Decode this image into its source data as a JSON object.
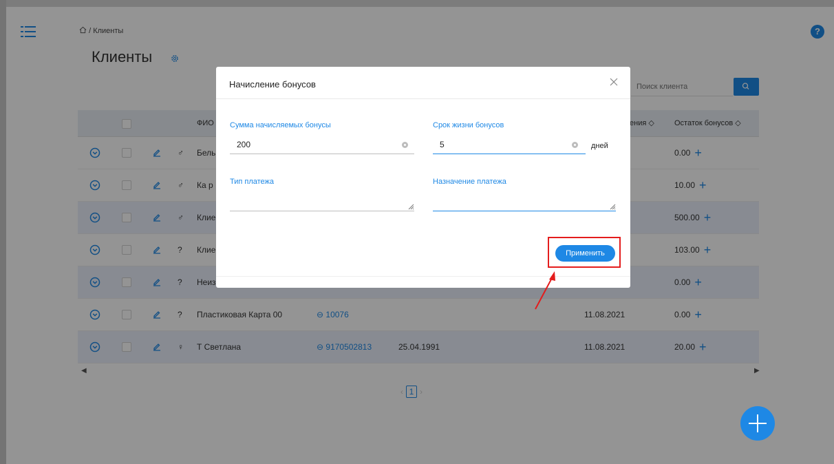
{
  "breadcrumb": {
    "home_icon": "home-icon",
    "separator": "/",
    "current": "Клиенты"
  },
  "page": {
    "title": "Клиенты",
    "settings_icon": "gear-icon"
  },
  "search": {
    "placeholder": "Поиск клиента",
    "icon": "search-icon"
  },
  "table": {
    "headers": {
      "name": "ФИО",
      "registration_partial": "ения ◇",
      "bonus_balance": "Остаток бонусов ◇"
    },
    "rows": [
      {
        "gender": "♂",
        "name": "Бель",
        "phone": "",
        "birthday": "",
        "registered": "",
        "bonus": "0.00"
      },
      {
        "gender": "♂",
        "name": "Ка р",
        "phone": "",
        "birthday": "",
        "registered": "",
        "bonus": "10.00"
      },
      {
        "gender": "♂",
        "name": "Клие",
        "phone": "",
        "birthday": "",
        "registered": "",
        "bonus": "500.00"
      },
      {
        "gender": "?",
        "name": "Клие",
        "phone": "",
        "birthday": "",
        "registered": "",
        "bonus": "103.00"
      },
      {
        "gender": "?",
        "name": "Неиз",
        "phone": "",
        "birthday": "",
        "registered": "",
        "bonus": "0.00"
      },
      {
        "gender": "?",
        "name": "Пластиковая Карта 00",
        "phone": "10076",
        "birthday": "",
        "registered": "11.08.2021",
        "bonus": "0.00"
      },
      {
        "gender": "♀",
        "name": "Т Светлана",
        "phone": "9170502813",
        "birthday": "25.04.1991",
        "registered": "11.08.2021",
        "bonus": "20.00"
      }
    ]
  },
  "pagination": {
    "prev": "‹",
    "current": "1",
    "next": "›"
  },
  "modal": {
    "title": "Начисление бонусов",
    "bonus_amount": {
      "label": "Сумма начисляемых бонусы",
      "value": "200"
    },
    "bonus_lifetime": {
      "label": "Срок жизни бонусов",
      "value": "5",
      "unit": "дней"
    },
    "payment_type": {
      "label": "Тип платежа",
      "value": ""
    },
    "payment_purpose": {
      "label": "Назначение платежа",
      "value": ""
    },
    "apply_label": "Применить"
  },
  "colors": {
    "accent": "#1e88e5",
    "highlight": "#e41c1c"
  }
}
